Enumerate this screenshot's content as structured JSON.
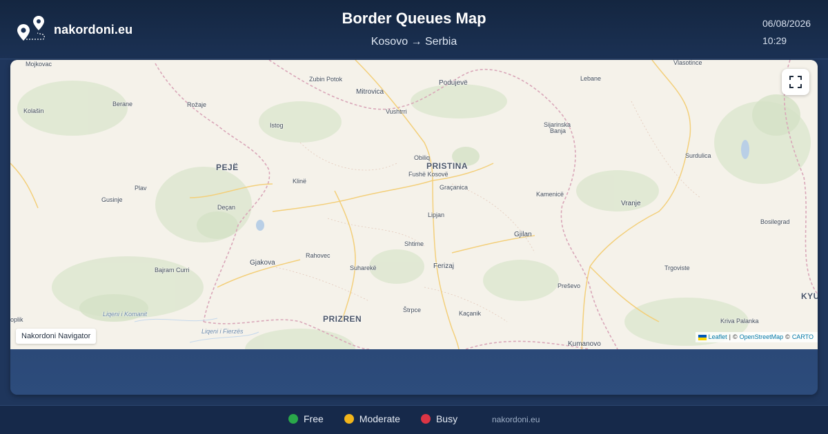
{
  "header": {
    "brand_name": "nakordoni.eu",
    "title": "Border Queues Map",
    "route": "Kosovo → Serbia",
    "date": "06/08/2026",
    "time": "10:29"
  },
  "map": {
    "nav_label": "Nakordoni Navigator",
    "attribution": {
      "leaflet": "Leaflet",
      "separator": "|",
      "copyright1": "©",
      "osm": "OpenStreetMap",
      "copyright2": "©",
      "carto": "CARTO"
    },
    "places": [
      {
        "name": "Mojkovac",
        "cls": "",
        "pos": "p1"
      },
      {
        "name": "Zubin Potok",
        "cls": "",
        "pos": "p2"
      },
      {
        "name": "Mitrovica",
        "cls": "med",
        "pos": "p3"
      },
      {
        "name": "Podujevë",
        "cls": "med",
        "pos": "p4"
      },
      {
        "name": "Lebane",
        "cls": "",
        "pos": "p5"
      },
      {
        "name": "Vlasotince",
        "cls": "",
        "pos": "p6"
      },
      {
        "name": "Berane",
        "cls": "",
        "pos": "p7"
      },
      {
        "name": "Rožaje",
        "cls": "",
        "pos": "p8"
      },
      {
        "name": "Kolašin",
        "cls": "",
        "pos": "p9"
      },
      {
        "name": "Vushtrri",
        "cls": "",
        "pos": "p10"
      },
      {
        "name": "Istog",
        "cls": "",
        "pos": "p11"
      },
      {
        "name": "Sijarinska",
        "cls": "",
        "pos": "p12"
      },
      {
        "name": "Banja",
        "cls": "",
        "pos": "p13"
      },
      {
        "name": "Obiliq",
        "cls": "",
        "pos": "p14"
      },
      {
        "name": "PRISTINA",
        "cls": "big",
        "pos": "p15"
      },
      {
        "name": "Fushë Kosovë",
        "cls": "",
        "pos": "p16"
      },
      {
        "name": "PEJË",
        "cls": "big",
        "pos": "p17"
      },
      {
        "name": "Surdulica",
        "cls": "",
        "pos": "p18"
      },
      {
        "name": "Klinë",
        "cls": "",
        "pos": "p19"
      },
      {
        "name": "Graçanica",
        "cls": "",
        "pos": "p20"
      },
      {
        "name": "Plav",
        "cls": "",
        "pos": "p21"
      },
      {
        "name": "Kamenicë",
        "cls": "",
        "pos": "p22"
      },
      {
        "name": "Gusinje",
        "cls": "",
        "pos": "p23"
      },
      {
        "name": "Vranje",
        "cls": "med",
        "pos": "p24"
      },
      {
        "name": "Deçan",
        "cls": "",
        "pos": "p25"
      },
      {
        "name": "Lipjan",
        "cls": "",
        "pos": "p26"
      },
      {
        "name": "Bosilegrad",
        "cls": "",
        "pos": "p27"
      },
      {
        "name": "Gjilan",
        "cls": "med",
        "pos": "p28"
      },
      {
        "name": "Shtime",
        "cls": "",
        "pos": "p29"
      },
      {
        "name": "Rahovec",
        "cls": "",
        "pos": "p30"
      },
      {
        "name": "Gjakova",
        "cls": "med",
        "pos": "p31"
      },
      {
        "name": "Suharekë",
        "cls": "",
        "pos": "p32"
      },
      {
        "name": "Ferizaj",
        "cls": "med",
        "pos": "p33"
      },
      {
        "name": "Bajram Curri",
        "cls": "",
        "pos": "p34"
      },
      {
        "name": "Trgoviste",
        "cls": "",
        "pos": "p35"
      },
      {
        "name": "Preševo",
        "cls": "",
        "pos": "p36"
      },
      {
        "name": "KYU",
        "cls": "big",
        "pos": "p37"
      },
      {
        "name": "Liqeni i Komanit",
        "cls": "water",
        "pos": "p38"
      },
      {
        "name": "Štrpce",
        "cls": "",
        "pos": "p39"
      },
      {
        "name": "Kaçanik",
        "cls": "",
        "pos": "p40"
      },
      {
        "name": "PRIZREN",
        "cls": "big",
        "pos": "p41"
      },
      {
        "name": "oplik",
        "cls": "",
        "pos": "p42"
      },
      {
        "name": "Kriva Palanka",
        "cls": "",
        "pos": "p43"
      },
      {
        "name": "Liqeni i Fierzës",
        "cls": "water",
        "pos": "p44"
      },
      {
        "name": "Kumanovo",
        "cls": "med",
        "pos": "p45"
      }
    ]
  },
  "legend": [
    {
      "label": "Free",
      "color": "#2aa84a"
    },
    {
      "label": "Moderate",
      "color": "#f2b51b"
    },
    {
      "label": "Busy",
      "color": "#dc3545"
    }
  ],
  "footer": {
    "site": "nakordoni.eu"
  }
}
